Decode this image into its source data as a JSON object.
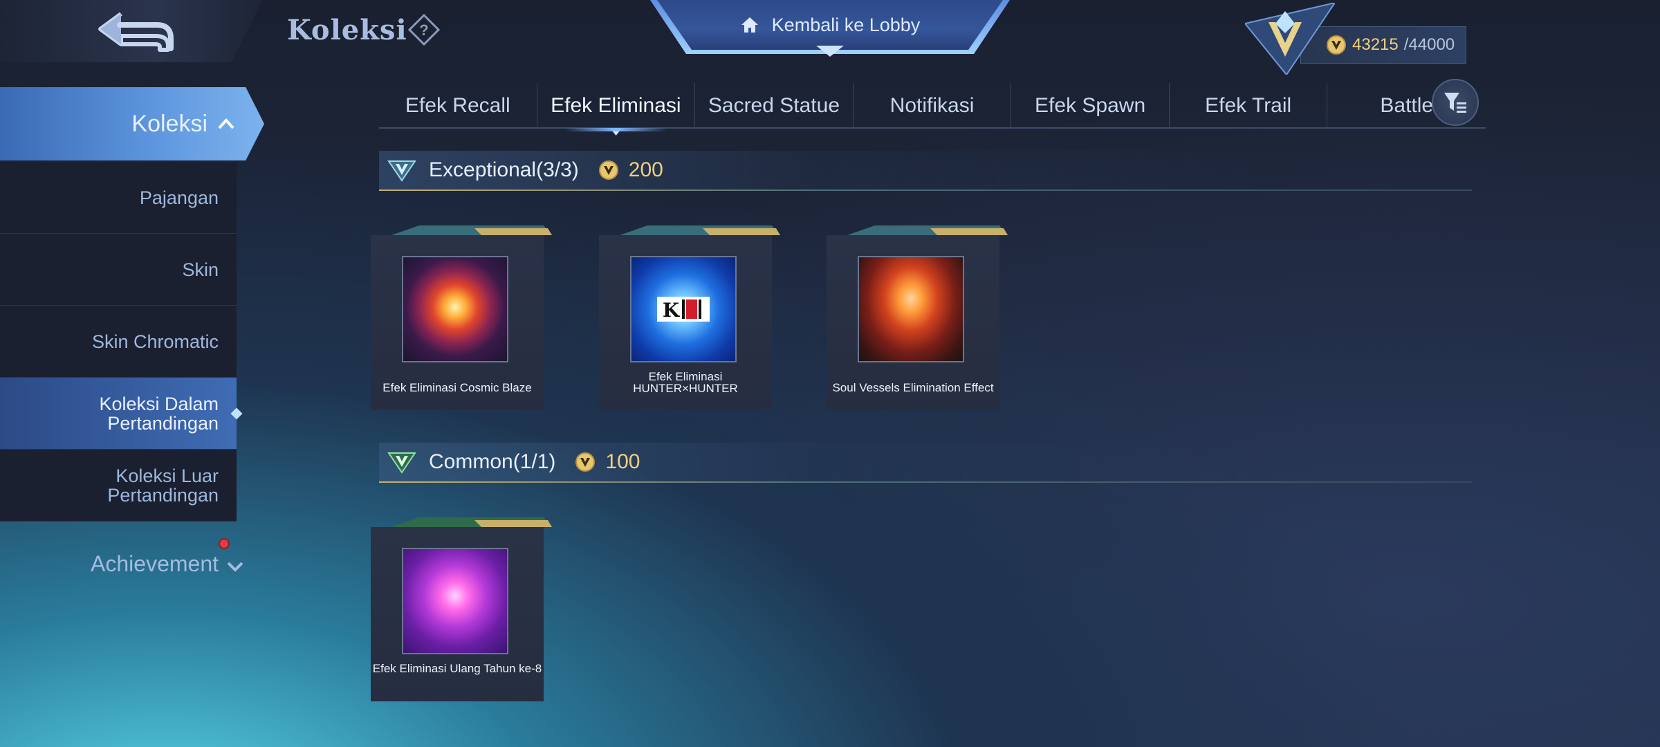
{
  "header": {
    "title": "Koleksi",
    "lobby_label": "Kembali ke Lobby",
    "points_current": "43215",
    "points_max": "/44000"
  },
  "sidebar": {
    "active_label": "Koleksi",
    "items": [
      {
        "label": "Pajangan"
      },
      {
        "label": "Skin"
      },
      {
        "label": "Skin Chromatic"
      },
      {
        "label": "Koleksi Dalam Pertandingan"
      },
      {
        "label": "Koleksi Luar Pertandingan"
      }
    ],
    "achievement_label": "Achievement"
  },
  "tabs": [
    {
      "label": "Efek Recall"
    },
    {
      "label": "Efek Eliminasi"
    },
    {
      "label": "Sacred Statue"
    },
    {
      "label": "Notifikasi"
    },
    {
      "label": "Efek Spawn"
    },
    {
      "label": "Efek Trail"
    },
    {
      "label": "Battle"
    }
  ],
  "active_tab": "Efek Eliminasi",
  "sections": [
    {
      "title": "Exceptional",
      "count": "(3/3)",
      "points": "200",
      "items": [
        {
          "name": "Efek Eliminasi Cosmic Blaze"
        },
        {
          "name": "Efek Eliminasi HUNTER×HUNTER"
        },
        {
          "name": "Soul Vessels Elimination Effect"
        }
      ]
    },
    {
      "title": "Common",
      "count": "(1/1)",
      "points": "100",
      "items": [
        {
          "name": "Efek Eliminasi Ulang Tahun ke-8"
        }
      ]
    }
  ],
  "colors": {
    "accent": "#5b94dc",
    "gold": "#f0cf7e",
    "panel": "#1a2030"
  }
}
